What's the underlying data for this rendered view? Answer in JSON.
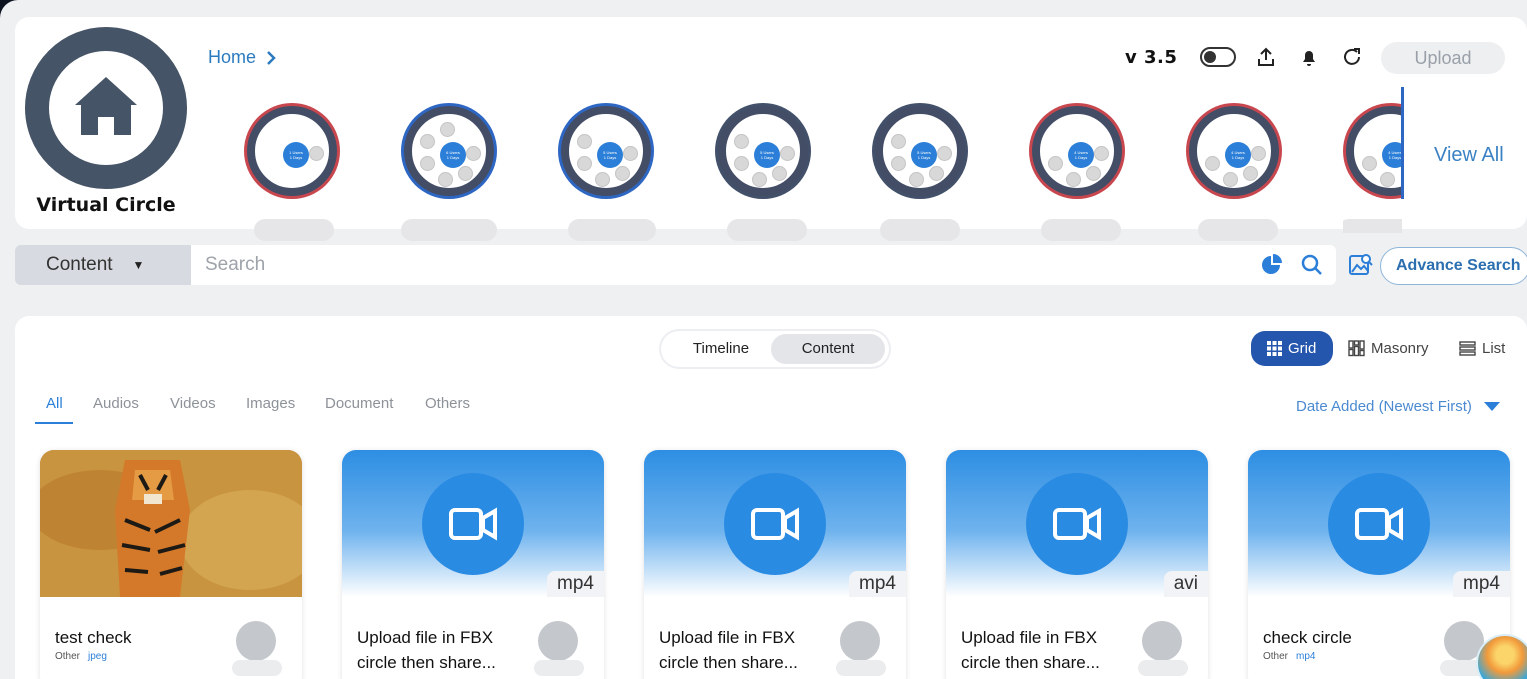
{
  "brand": {
    "title": "Virtual Circle"
  },
  "breadcrumb": {
    "home": "Home"
  },
  "header": {
    "version": "v 3.5",
    "upload_label": "Upload",
    "view_all": "View All"
  },
  "circles": [
    {
      "users": "1 Users",
      "days": "1 Days",
      "ring": "red"
    },
    {
      "users": "6 Users",
      "days": "1 Days",
      "ring": "blue"
    },
    {
      "users": "5 Users",
      "days": "1 Days",
      "ring": "blue"
    },
    {
      "users": "5 Users",
      "days": "1 Days",
      "ring": "dark"
    },
    {
      "users": "5 Users",
      "days": "1 Days",
      "ring": "dark"
    },
    {
      "users": "4 Users",
      "days": "1 Days",
      "ring": "red"
    },
    {
      "users": "4 Users",
      "days": "1 Days",
      "ring": "red"
    },
    {
      "users": "4 Users",
      "days": "1 Days",
      "ring": "red"
    }
  ],
  "search": {
    "scope": "Content",
    "placeholder": "Search",
    "advance_label": "Advance Search"
  },
  "view": {
    "timeline": "Timeline",
    "content": "Content"
  },
  "layouts": {
    "grid": "Grid",
    "masonry": "Masonry",
    "list": "List"
  },
  "categories": [
    "All",
    "Audios",
    "Videos",
    "Images",
    "Document",
    "Others"
  ],
  "sort": {
    "label": "Date Added (Newest First)"
  },
  "cards": [
    {
      "title": "test check",
      "type": "Other",
      "ext": "jpeg",
      "tag": ""
    },
    {
      "title": "Upload file in FBX circle then share...",
      "type": "",
      "ext": "",
      "tag": "mp4"
    },
    {
      "title": "Upload file in FBX circle then share...",
      "type": "",
      "ext": "",
      "tag": "mp4"
    },
    {
      "title": "Upload file in FBX circle then share...",
      "type": "",
      "ext": "",
      "tag": "avi"
    },
    {
      "title": "check circle",
      "type": "Other",
      "ext": "mp4",
      "tag": "mp4"
    }
  ],
  "colors": {
    "accent": "#2c7fd8",
    "brand_ring": "#465467",
    "grid_active": "#2556ad"
  }
}
